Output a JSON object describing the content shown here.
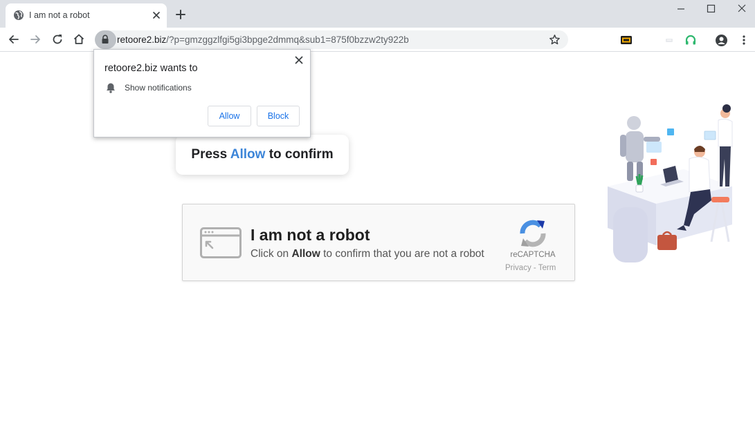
{
  "tab": {
    "title": "I am not a robot"
  },
  "address_bar": {
    "domain": "retoore2.biz",
    "path": "/?p=gmzggzlfgi5gi3bpge2dmmq&sub1=875f0bzzw2ty922b"
  },
  "permission_prompt": {
    "title": "retoore2.biz wants to",
    "permission": "Show notifications",
    "allow_label": "Allow",
    "block_label": "Block"
  },
  "press_banner": {
    "prefix": "Press",
    "highlight": "Allow",
    "suffix": "to confirm"
  },
  "captcha": {
    "title": "I am not a robot",
    "subtitle_prefix": "Click on",
    "subtitle_highlight": "Allow",
    "subtitle_suffix": "to confirm that you are not a robot",
    "brand": "reCAPTCHA",
    "links": "Privacy - Term"
  },
  "colors": {
    "accent_blue": "#3c85d8",
    "button_blue": "#1a73e8",
    "tab_strip": "#dee1e6"
  },
  "icons": {
    "tab": [
      "globe-icon",
      "close-icon",
      "plus-icon"
    ],
    "toolbar": [
      "back-icon",
      "forward-icon",
      "reload-icon",
      "home-icon",
      "lock-icon",
      "star-icon",
      "account-icon",
      "menu-icon"
    ],
    "window": [
      "minimize-icon",
      "maximize-icon",
      "window-close-icon"
    ],
    "page": [
      "bell-icon",
      "browser-window-icon",
      "recaptcha-logo"
    ]
  }
}
